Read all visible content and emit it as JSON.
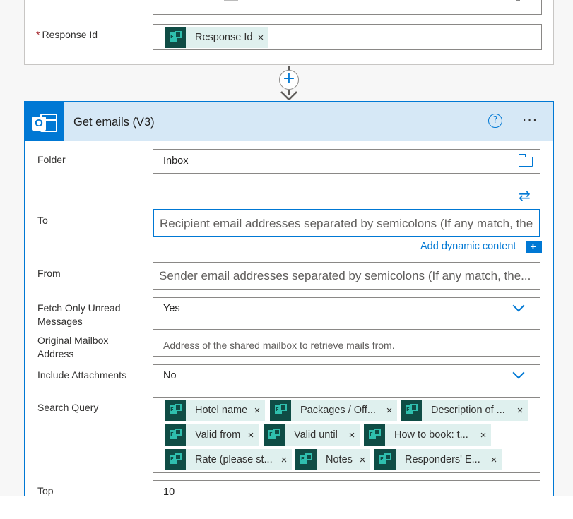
{
  "previous_step": {
    "response_id_label": "Response Id",
    "required_mark": "*",
    "response_id_token": "Response Id"
  },
  "connector": {
    "plus": "+"
  },
  "card": {
    "title": "Get emails (V3)",
    "help": "?",
    "more": "···",
    "icon": "outlook-icon"
  },
  "fields": {
    "folder": {
      "label": "Folder",
      "value": "Inbox"
    },
    "to": {
      "label": "To",
      "placeholder": "Recipient email addresses separated by semicolons (If any match, the"
    },
    "add_dynamic": "Add dynamic content",
    "add_dynamic_icon": "+",
    "from": {
      "label": "From",
      "placeholder": "Sender email addresses separated by semicolons (If any match, the..."
    },
    "fetch_unread": {
      "label": "Fetch Only Unread Messages",
      "value": "Yes"
    },
    "original_mailbox": {
      "label": "Original Mailbox Address",
      "placeholder": "Address of the shared mailbox to retrieve mails from."
    },
    "include_attachments": {
      "label": "Include Attachments",
      "value": "No"
    },
    "search_query": {
      "label": "Search Query",
      "tokens": [
        "Hotel name",
        "Packages / Off...",
        "Description of ...",
        "Valid from",
        "Valid until",
        "How to book: t...",
        "Rate (please st...",
        "Notes",
        "Responders' E..."
      ]
    },
    "top": {
      "label": "Top",
      "value": "10"
    }
  },
  "token_close": "×",
  "colors": {
    "accent": "#0078d4",
    "header_bg": "#d6e8f6",
    "token_bg": "#dff0ee",
    "token_icon": "#0f4c45"
  }
}
